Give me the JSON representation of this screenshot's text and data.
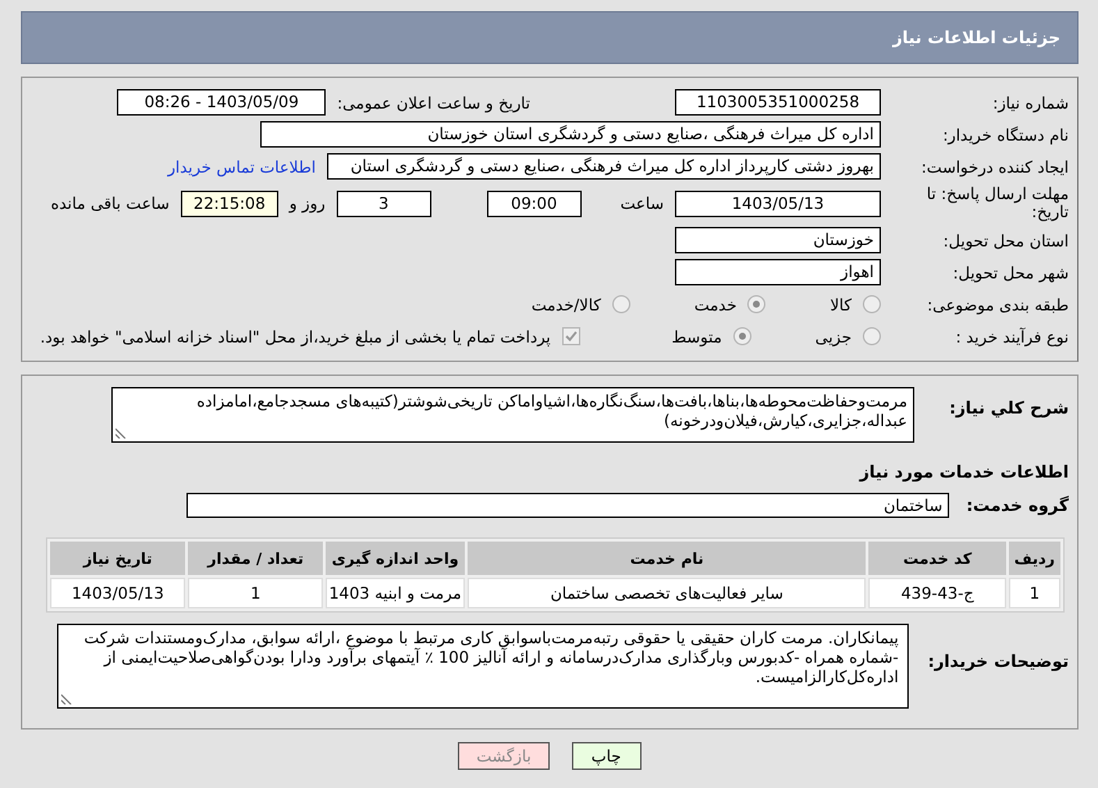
{
  "header": {
    "title": "جزئیات اطلاعات نیاز"
  },
  "need_number": {
    "label": "شماره نیاز:",
    "value": "1103005351000258"
  },
  "announce_datetime": {
    "label": "تاریخ و ساعت اعلان عمومی:",
    "value": "1403/05/09 - 08:26"
  },
  "buyer_org": {
    "label": "نام دستگاه خریدار:",
    "value": "اداره کل میراث فرهنگی ،صنایع دستی و گردشگری استان خوزستان"
  },
  "requester": {
    "label": "ایجاد کننده درخواست:",
    "value": "بهروز دشتی کارپرداز اداره کل میراث فرهنگی ،صنایع دستی و گردشگری استان",
    "link": "اطلاعات تماس خریدار"
  },
  "deadline": {
    "label": "مهلت ارسال پاسخ: تا تاریخ:",
    "date": "1403/05/13",
    "time_label": "ساعت",
    "time": "09:00",
    "days": "3",
    "days_label": "روز و",
    "remaining": "22:15:08",
    "remaining_label": "ساعت باقی مانده"
  },
  "province": {
    "label": "استان محل تحویل:",
    "value": "خوزستان"
  },
  "city": {
    "label": "شهر محل تحویل:",
    "value": "اهواز"
  },
  "category": {
    "label": "طبقه بندی موضوعی:",
    "options": [
      {
        "label": "کالا",
        "selected": false
      },
      {
        "label": "خدمت",
        "selected": true
      },
      {
        "label": "کالا/خدمت",
        "selected": false
      }
    ]
  },
  "purchase_type": {
    "label": "نوع فرآیند خرید :",
    "options": [
      {
        "label": "جزیی",
        "selected": false
      },
      {
        "label": "متوسط",
        "selected": true
      }
    ],
    "treasury": {
      "checked": true,
      "label": "پرداخت تمام یا بخشی از مبلغ خرید،از محل \"اسناد خزانه اسلامی\" خواهد بود."
    }
  },
  "description": {
    "label": "شرح کلي نیاز:",
    "value": "مرمت‌وحفاظت‌محوطه‌ها،بناها،بافت‌ها،سنگ‌نگاره‌ها،اشیاواماکن تاریخی‌شوشتر(کتیبه‌های مسجدجامع،امامزاده عبداله،جزایری،کیارش،فیلان‌ودرخونه)"
  },
  "services_heading": "اطلاعات خدمات مورد نیاز",
  "service_group": {
    "label": "گروه خدمت:",
    "value": "ساختمان"
  },
  "table": {
    "columns": [
      "ردیف",
      "کد خدمت",
      "نام خدمت",
      "واحد اندازه گیری",
      "تعداد / مقدار",
      "تاریخ نیاز"
    ],
    "rows": [
      [
        "1",
        "ج-43-439",
        "سایر فعالیت‌های تخصصی ساختمان",
        "مرمت و ابنیه 1403",
        "1",
        "1403/05/13"
      ]
    ]
  },
  "buyer_notes": {
    "label": "توضیحات خریدار:",
    "value": "پیمانکاران. مرمت کاران حقیقی یا حقوقی رتبه‌مرمت‌باسوابق کاری مرتبط با موضوع ،ارائه سوابق، مدارک‌ومستندات شرکت -شماره همراه -کدبورس وبارگذاری مدارک‌درسامانه و ارائه آنالیز 100 ٪ آیتمهای برآورد ودارا بودن‌گواهی‌صلاحیت‌ایمنی از اداره‌کل‌کارالزامیست."
  },
  "buttons": [
    {
      "label": "چاپ",
      "kind": "print"
    },
    {
      "label": "بازگشت",
      "kind": "back"
    }
  ]
}
